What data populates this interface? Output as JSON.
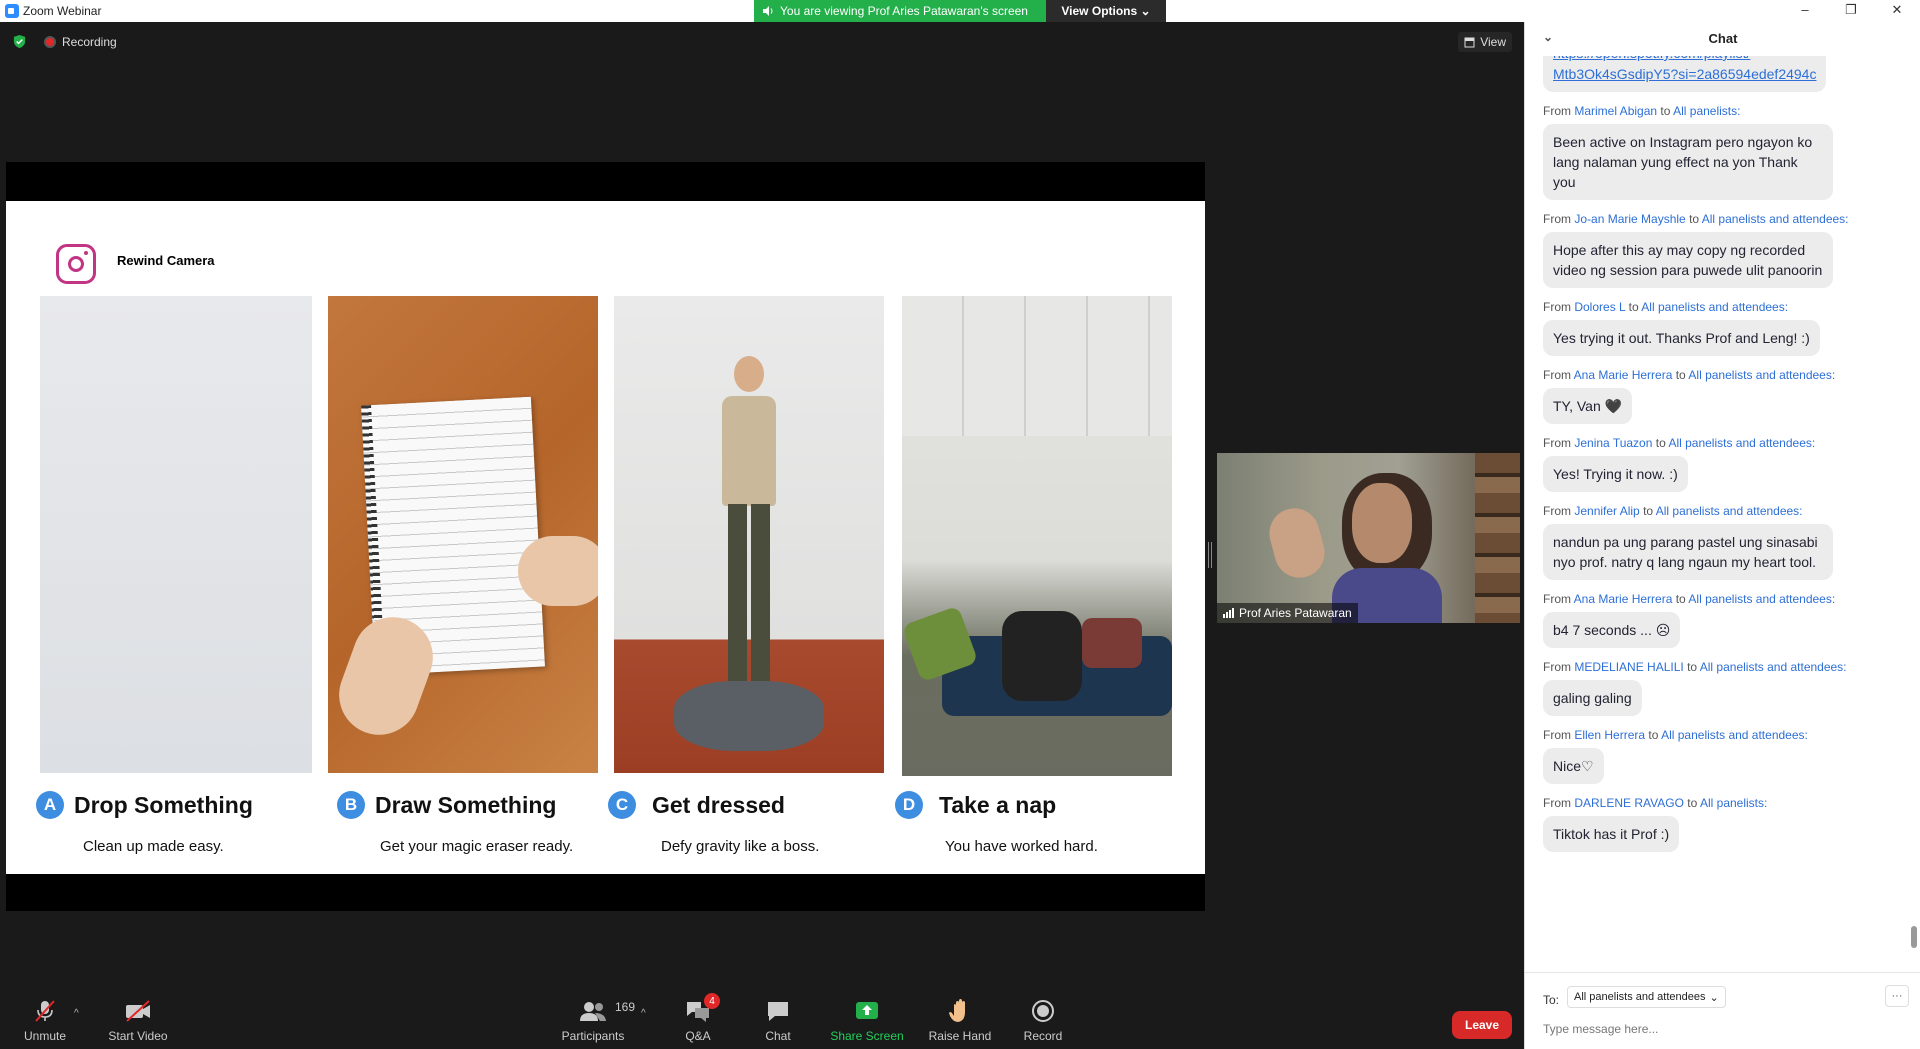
{
  "window": {
    "title": "Zoom Webinar",
    "controls": [
      "–",
      "❐",
      "✕"
    ]
  },
  "share_banner": {
    "text": "You are viewing Prof Aries Patawaran's screen",
    "view_options": "View Options"
  },
  "meeting": {
    "recording_label": "Recording",
    "view_label": "View"
  },
  "slide": {
    "title": "Rewind Camera",
    "panels": [
      {
        "letter": "A",
        "title": "Drop Something",
        "subtitle": "Clean up made easy."
      },
      {
        "letter": "B",
        "title": "Draw Something",
        "subtitle": "Get your magic eraser ready."
      },
      {
        "letter": "C",
        "title": "Get dressed",
        "subtitle": "Defy gravity like a boss."
      },
      {
        "letter": "D",
        "title": "Take a nap",
        "subtitle": "You have worked hard."
      }
    ]
  },
  "presenter": {
    "name": "Prof Aries Patawaran"
  },
  "toolbar": {
    "unmute": "Unmute",
    "start_video": "Start Video",
    "participants": "Participants",
    "participants_count": "169",
    "qa": "Q&A",
    "qa_badge": "4",
    "chat": "Chat",
    "share_screen": "Share Screen",
    "raise_hand": "Raise Hand",
    "record": "Record",
    "leave": "Leave"
  },
  "chat": {
    "header": "Chat",
    "top_link": "Mtb3Ok4sGsdipY5?si=2a86594edef2494c",
    "messages": [
      {
        "from": "Marimel Abigan",
        "to": "All panelists:",
        "text": "Been active on Instagram pero ngayon ko lang nalaman yung effect na yon Thank you"
      },
      {
        "from": "Jo-an  Marie Mayshle",
        "to": "All panelists and attendees:",
        "text": "Hope after this ay may copy ng recorded video ng session para puwede ulit panoorin"
      },
      {
        "from": "Dolores L",
        "to": "All panelists and attendees:",
        "text": "Yes trying it out. Thanks Prof and Leng! :)"
      },
      {
        "from": "Ana Marie Herrera",
        "to": "All panelists and attendees:",
        "text": "TY, Van 🖤"
      },
      {
        "from": "Jenina Tuazon",
        "to": "All panelists and attendees:",
        "text": "Yes! Trying it now. :)"
      },
      {
        "from": "Jennifer Alip",
        "to": "All panelists and attendees:",
        "text": "nandun pa ung parang pastel ung sinasabi nyo prof. natry q lang ngaun my heart tool."
      },
      {
        "from": "Ana Marie Herrera",
        "to": "All panelists and attendees:",
        "text": "b4 7 seconds ... ☹"
      },
      {
        "from": "MEDELIANE HALILI",
        "to": "All panelists and attendees:",
        "text": "galing galing"
      },
      {
        "from": "Ellen Herrera",
        "to": "All panelists and attendees:",
        "text": "Nice♡"
      },
      {
        "from": "DARLENE RAVAGO",
        "to": "All panelists:",
        "text": "Tiktok has it Prof :)"
      }
    ],
    "from_word": "From",
    "to_word": "to",
    "to_label": "To:",
    "to_value": "All panelists and attendees",
    "more": "···",
    "input_placeholder": "Type message here..."
  },
  "colors": {
    "share_green": "#23b04a",
    "leave_red": "#d72a28",
    "link_blue": "#2d6fd6",
    "badge_blue": "#3d8de0"
  }
}
